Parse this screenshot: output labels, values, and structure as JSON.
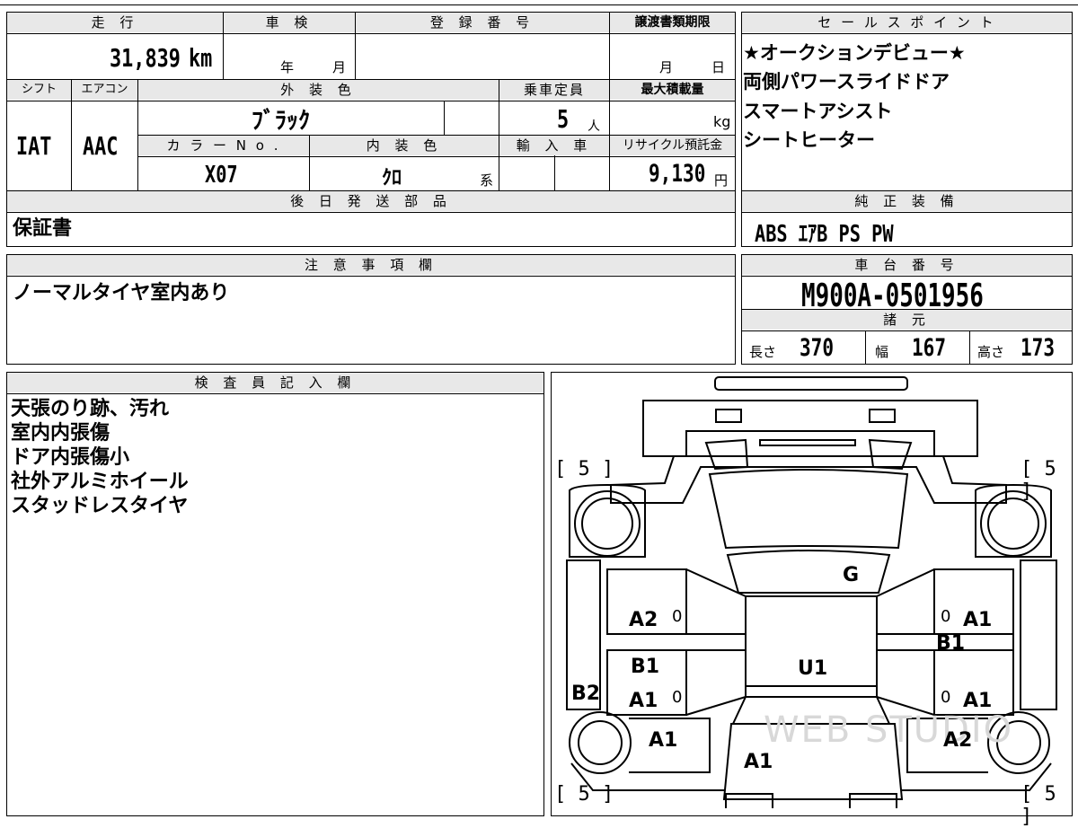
{
  "labels": {
    "mileage": "走 行",
    "inspection": "車 検",
    "registration_no": "登 録 番 号",
    "transfer_deadline": "譲渡書類期限",
    "shift": "シフト",
    "aircon": "エアコン",
    "exterior_color": "外 装 色",
    "capacity": "乗車定員",
    "max_load": "最大積載量",
    "color_no": "カ ラ ー N o .",
    "interior_color": "内 装 色",
    "import": "輸 入 車",
    "recycle_fee": "リサイクル預託金",
    "later_parts": "後 日 発 送 部 品",
    "sales_points": "セ ー ル ス ポ イ ン ト",
    "standard_equipment": "純 正 装 備",
    "notes": "注 意 事 項 欄",
    "chassis_no": "車 台 番 号",
    "specs": "諸 元",
    "inspector_notes": "検 査 員 記 入 欄"
  },
  "vehicle": {
    "mileage_value": "31,839",
    "mileage_unit": "km",
    "inspection_year": "年",
    "inspection_month": "月",
    "deadline_month": "月",
    "deadline_day": "日",
    "shift": "IAT",
    "aircon": "AAC",
    "exterior_color": "ﾌﾞﾗｯｸ",
    "capacity_value": "5",
    "capacity_unit": "人",
    "max_load_unit": "kg",
    "color_no": "X07",
    "interior_color": "ｸﾛ",
    "interior_suffix": "系",
    "recycle_value": "9,130",
    "recycle_unit": "円"
  },
  "later_parts": "保証書",
  "sales_points": [
    "★オークションデビュー★",
    "両側パワースライドドア",
    "スマートアシスト",
    "シートヒーター"
  ],
  "standard_equipment": "ABS ｴｱB PS PW",
  "notes": "ノーマルタイヤ室内あり",
  "chassis_no": "M900A-0501956",
  "specs": {
    "length_label": "長さ",
    "length": "370",
    "width_label": "幅",
    "width": "167",
    "height_label": "高さ",
    "height": "173"
  },
  "inspector_notes": [
    "天張のり跡、汚れ",
    "室内内張傷",
    "ドア内張傷小",
    "社外アルミホイール",
    "スタッドレスタイヤ"
  ],
  "diagram": {
    "tire_fl": "[ 5 ]",
    "tire_fr": "[ 5 ]",
    "tire_rl": "[ 5 ]",
    "tire_rr": "[ 5 ]",
    "marks": {
      "g": "G",
      "u1": "U1",
      "a2_left_upper": "A2",
      "a1_right_upper": "A1",
      "b1_left": "B1",
      "b1_right": "B1",
      "a1_left_mid": "A1",
      "a1_right_mid": "A1",
      "b2_left": "B2",
      "a1_left_lower": "A1",
      "a2_right_lower": "A2",
      "a1_rear": "A1",
      "zero": "0"
    },
    "watermark": "WEB STUDIO"
  }
}
